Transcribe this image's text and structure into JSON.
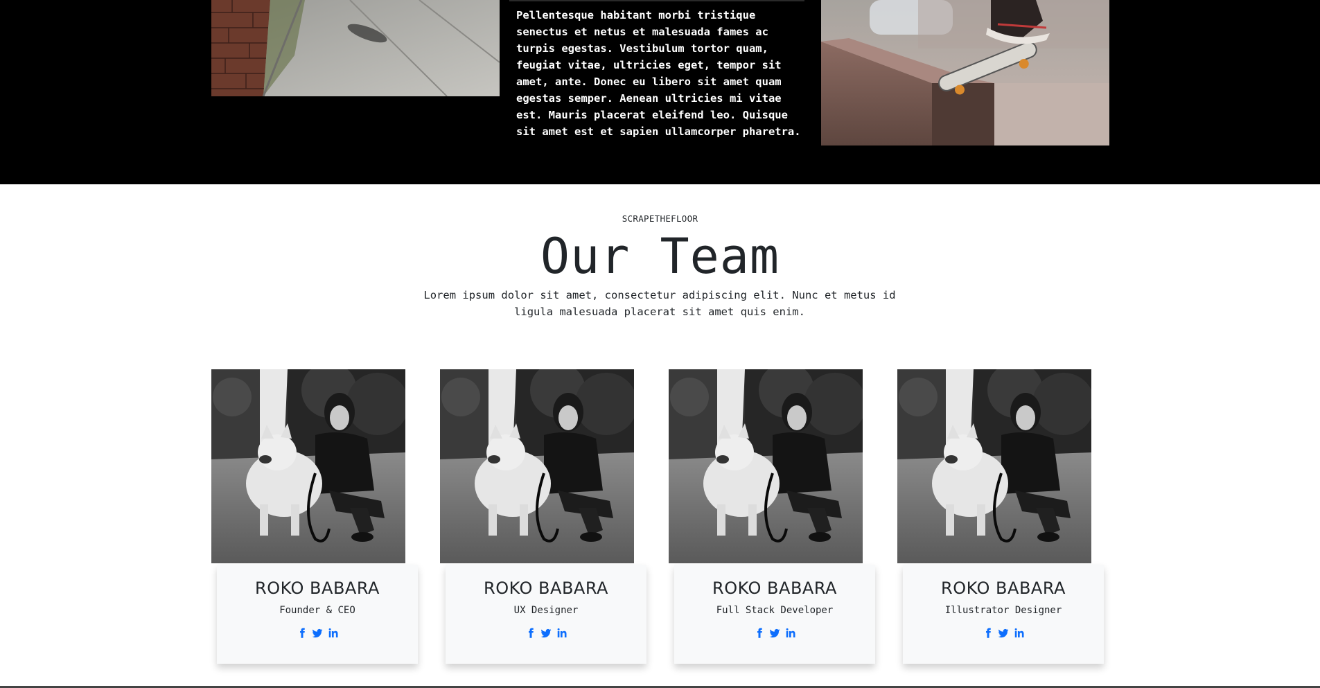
{
  "intro": {
    "paragraph": "Pellentesque habitant morbi tristique senectus et netus et malesuada fames ac turpis egestas. Vestibulum tortor quam, feugiat vitae, ultricies eget, tempor sit amet, ante. Donec eu libero sit amet quam egestas semper. Aenean ultricies mi vitae est. Mauris placerat eleifend leo. Quisque sit amet est et sapien ullamcorper pharetra."
  },
  "team": {
    "eyebrow": "SCRAPETHEFLOOR",
    "title": "Our Team",
    "lead": "Lorem ipsum dolor sit amet, consectetur adipiscing elit. Nunc et metus id ligula malesuada placerat sit amet quis enim.",
    "members": [
      {
        "name": "ROKO BABARA",
        "role": "Founder & CEO"
      },
      {
        "name": "ROKO BABARA",
        "role": "UX Designer"
      },
      {
        "name": "ROKO BABARA",
        "role": "Full Stack Developer"
      },
      {
        "name": "ROKO BABARA",
        "role": "Illustrator Designer"
      }
    ],
    "social_icons": [
      "facebook-icon",
      "twitter-icon",
      "linkedin-icon"
    ]
  },
  "colors": {
    "dark_band": "#000000",
    "card_bg": "#f8f9fa",
    "social": "#0d6efd",
    "text": "#212529"
  }
}
